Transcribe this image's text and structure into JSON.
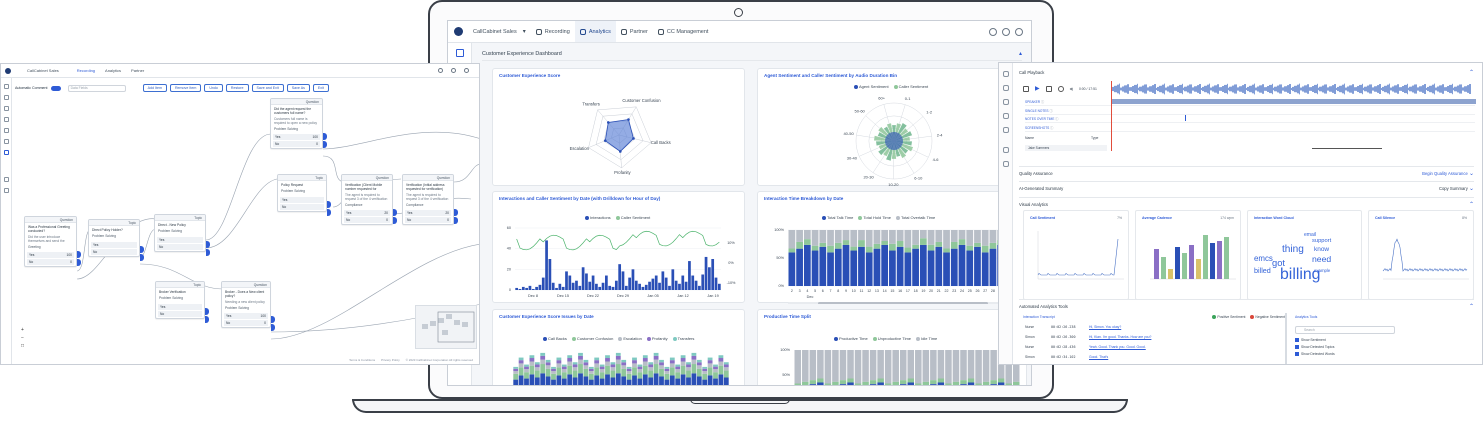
{
  "laptop": {
    "nav": {
      "workspace": "CallCabinet Sales",
      "items": [
        "Recording",
        "Analytics",
        "Partner",
        "CC Management"
      ],
      "active": 1
    },
    "dashboard_title": "Customer Experience Dashboard",
    "cards": {
      "radar": {
        "title": "Customer Experience Score",
        "axes": [
          "Customer Confusion",
          "Call Backs",
          "Profanity",
          "Escalation",
          "Transfers"
        ],
        "values": [
          0.55,
          0.45,
          0.5,
          0.45,
          0.5
        ]
      },
      "polar": {
        "title": "Agent Sentiment and Caller Sentiment by Audio Duration Bin",
        "legend": [
          "Agent Sentiment",
          "Caller Sentiment"
        ],
        "bins": [
          "0-1",
          "1-2",
          "2-4",
          "4-6",
          "6-10",
          "10-20",
          "20-30",
          "30-40",
          "40-50",
          "50-60",
          "60+"
        ]
      },
      "interactions": {
        "title": "Interactions and Caller Sentiment by Date (with Drilldown for Hour of Day)",
        "legend": [
          "Interactions",
          "Caller Sentiment"
        ],
        "x_ticks": [
          "Dec 8",
          "Dec 15",
          "Dec 22",
          "Dec 29",
          "Jan 05",
          "Jan 12",
          "Jan 19"
        ],
        "y_ticks": [
          "60",
          "40",
          "20",
          "0"
        ],
        "y2_ticks": [
          "10%",
          "0%",
          "-10%"
        ]
      },
      "breakdown": {
        "title": "Interaction Time Breakdown by Date",
        "legend": [
          "Total Talk Time",
          "Total Hold Time",
          "Total Overtalk Time"
        ],
        "y_ticks": [
          "100%",
          "50%",
          "0%"
        ],
        "x_ticks": [
          "2",
          "3",
          "4",
          "5",
          "6",
          "7",
          "8",
          "9",
          "10",
          "11",
          "12",
          "13",
          "14",
          "15",
          "16",
          "17",
          "18",
          "19",
          "20",
          "21",
          "22",
          "23",
          "24",
          "25",
          "26",
          "27",
          "28",
          "29",
          "30",
          "31"
        ],
        "month": "Dec",
        "month2": "Jan"
      },
      "issues": {
        "title": "Customer Experience Score Issues by Date",
        "legend": [
          "Call Backs",
          "Customer Confusion",
          "Escalation",
          "Profanity",
          "Transfers"
        ]
      },
      "productive": {
        "title": "Productive Time Split",
        "legend": [
          "Productive Time",
          "Unproductive Time",
          "Idle Time"
        ],
        "y_ticks": [
          "100%",
          "50%",
          "0%"
        ]
      }
    },
    "colors": {
      "navy": "#2a4fb6",
      "green": "#8fc79a",
      "grey": "#b8bec7",
      "purple": "#8a6fc5",
      "gold": "#d9c26a",
      "teal": "#7fc9c1",
      "accent": "#2e5bd6"
    }
  },
  "left_window": {
    "nav": {
      "workspace": "CallCabinet Sales",
      "items": [
        "Recording",
        "Analytics",
        "Partner"
      ]
    },
    "toolbar": {
      "toggle_label": "Automatic Comment",
      "search_placeholder": "Data Fields",
      "buttons": [
        "Add Item",
        "Remove Item",
        "Undo",
        "Restore",
        "Save and Exit",
        "Save As",
        "Exit"
      ]
    },
    "nodes": [
      {
        "type": "Question",
        "text": "Was a Professional Greeting conducted?",
        "sub": "Did the user introduce themselves and send the",
        "label": "Greeting",
        "rows": [
          "Yes",
          "No"
        ],
        "scores": [
          "100",
          "0"
        ]
      },
      {
        "type": "Topic",
        "text": "Direct Policy Holder?",
        "sub": "",
        "label": "Problem Solving",
        "rows": [
          "Yes",
          "No"
        ],
        "scores": [
          "",
          ""
        ]
      },
      {
        "type": "Topic",
        "text": "Direct - New Policy",
        "sub": "",
        "label": "Problem Solving",
        "rows": [
          "Yes",
          "No"
        ],
        "scores": [
          "",
          ""
        ]
      },
      {
        "type": "Question",
        "text": "Did the agent request the customers full name?",
        "sub": "Customers full name is required to open a new policy",
        "label": "Problem Solving",
        "rows": [
          "Yes",
          "No"
        ],
        "scores": [
          "100",
          "0"
        ]
      },
      {
        "type": "Topic",
        "text": "Policy Request",
        "sub": "",
        "label": "Problem Solving",
        "rows": [
          "Yes",
          "No"
        ],
        "scores": [
          "",
          ""
        ]
      },
      {
        "type": "Question",
        "text": "Verification (Client Mobile number requested for",
        "sub": "The agent is required to request 3 of the 4 verification",
        "label": "Compliance",
        "rows": [
          "Yes",
          "No"
        ],
        "scores": [
          "20",
          "0"
        ]
      },
      {
        "type": "Question",
        "text": "Verification (Initial address requested for verification)",
        "sub": "The agent is required to request 3 of the 4 verification",
        "label": "Compliance",
        "rows": [
          "Yes",
          "No"
        ],
        "scores": [
          "20",
          "0"
        ]
      },
      {
        "type": "Topic",
        "text": "Broker Verification",
        "sub": "",
        "label": "Problem Solving",
        "rows": [
          "Yes",
          "No"
        ],
        "scores": [
          "",
          ""
        ]
      },
      {
        "type": "Question",
        "text": "Broker - Does a New client policy?",
        "sub": "Needing a new client policy",
        "label": "Problem Solving",
        "rows": [
          "Yes",
          "No"
        ],
        "scores": [
          "100",
          "0"
        ]
      }
    ],
    "footer": [
      "Terms & Conditions",
      "Privacy Policy",
      "© 2023 CallCabinet Corporation All rights reserved"
    ]
  },
  "right_window": {
    "call_playback": "Call Playback",
    "time": "0:00 / 17:51",
    "tracks": [
      "SPEAKER",
      "SINGLE NOTES",
      "NOTES OVER TIME",
      "SCREENSHOTS"
    ],
    "table_headers": [
      "Name",
      "Type"
    ],
    "table_row": "Jake Summers",
    "quality": {
      "label": "Quality Assurance",
      "action": "Begin Quality Assurance"
    },
    "ai_summary": {
      "label": "AI-Generated Summary",
      "action": "Copy Summary"
    },
    "visual": {
      "label": "Visual Analytics",
      "cards": [
        {
          "title": "Call Sentiment",
          "value": "7%"
        },
        {
          "title": "Average Cadence",
          "value": "174 wpm"
        },
        {
          "title": "Interaction Word Cloud",
          "value": ""
        },
        {
          "title": "Call Silence",
          "value": "8%"
        }
      ]
    },
    "words": [
      {
        "t": "billing",
        "s": 22
      },
      {
        "t": "thing",
        "s": 14
      },
      {
        "t": "got",
        "s": 13
      },
      {
        "t": "need",
        "s": 12
      },
      {
        "t": "emcs",
        "s": 11
      },
      {
        "t": "billed",
        "s": 10
      },
      {
        "t": "know",
        "s": 9
      },
      {
        "t": "support",
        "s": 8
      },
      {
        "t": "email",
        "s": 7
      },
      {
        "t": "example",
        "s": 6
      }
    ],
    "auto": {
      "label": "Automated Analytics Tools",
      "transcript_label": "Interaction Transcript",
      "pos": "Positive Sentiment",
      "neg": "Negative Sentiment",
      "tools_label": "Analytics Tools",
      "search": "Search",
      "rows": [
        {
          "who": "Nurse",
          "time": "00:02:26.238",
          "text": "Hi, Simon. You okay?"
        },
        {
          "who": "Simon",
          "time": "00:02:26.300",
          "text": "Hi, Kian. I'm good. Thanks. How are you?"
        },
        {
          "who": "Nurse",
          "time": "00:02:28.436",
          "text": "Yeah. Good. Thank you. Good. Good."
        },
        {
          "who": "Simon",
          "time": "00:02:34.102",
          "text": "Good. That's"
        }
      ],
      "checks": [
        "Show Sentiment",
        "Show Detected Topics",
        "Show Detected Words"
      ]
    }
  }
}
